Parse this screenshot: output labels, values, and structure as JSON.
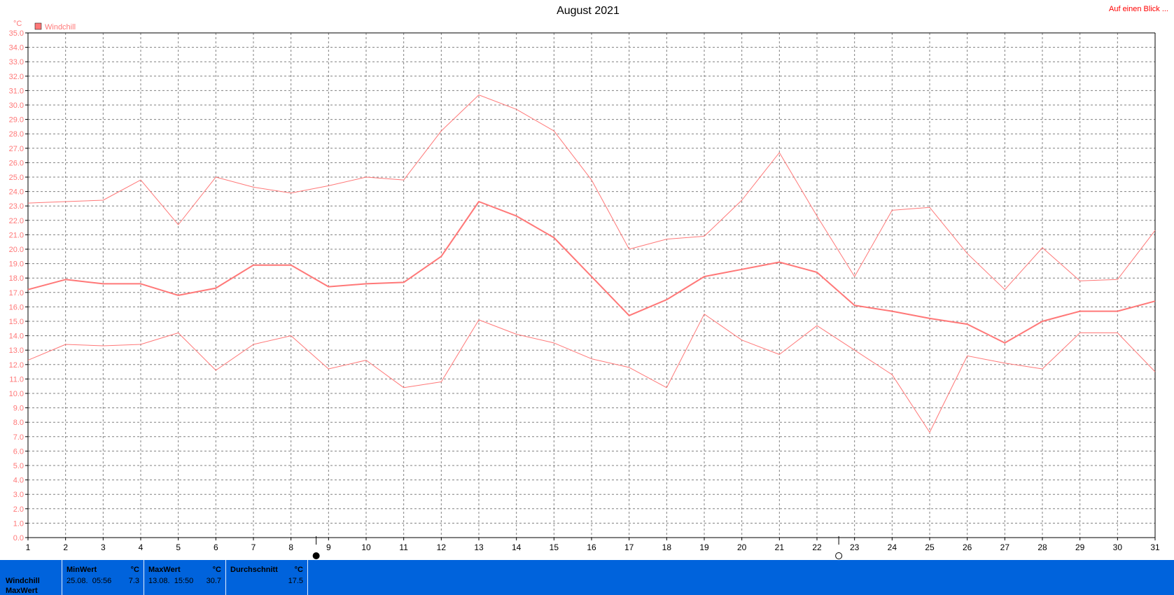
{
  "chart_data": {
    "type": "line",
    "title": "August 2021",
    "link": "Auf einen Blick ...",
    "yunit": "°C",
    "ylim": [
      0,
      35
    ],
    "ytick_step": 1,
    "x": [
      1,
      2,
      3,
      4,
      5,
      6,
      7,
      8,
      9,
      10,
      11,
      12,
      13,
      14,
      15,
      16,
      17,
      18,
      19,
      20,
      21,
      22,
      23,
      24,
      25,
      26,
      27,
      28,
      29,
      30,
      31
    ],
    "legend": [
      {
        "name": "Windchill",
        "color": "#ff7878"
      }
    ],
    "grid": true,
    "series": [
      {
        "role": "max",
        "color": "#ff7878",
        "width": 1,
        "values": [
          23.2,
          23.3,
          23.4,
          24.8,
          21.7,
          25.0,
          24.3,
          23.9,
          24.4,
          25.0,
          24.8,
          28.2,
          30.7,
          29.7,
          28.2,
          24.8,
          20.0,
          20.7,
          20.9,
          23.4,
          26.7,
          22.3,
          18.1,
          22.7,
          22.9,
          19.7,
          17.2,
          20.1,
          17.8,
          17.9,
          21.3
        ]
      },
      {
        "role": "avg",
        "color": "#ff7878",
        "width": 2,
        "values": [
          17.2,
          17.9,
          17.6,
          17.6,
          16.8,
          17.3,
          18.9,
          18.9,
          17.4,
          17.6,
          17.7,
          19.5,
          23.3,
          22.3,
          20.8,
          18.1,
          15.4,
          16.5,
          18.1,
          18.6,
          19.1,
          18.4,
          16.1,
          15.7,
          15.2,
          14.8,
          13.5,
          15.0,
          15.7,
          15.7,
          16.4
        ]
      },
      {
        "role": "min",
        "color": "#ff7878",
        "width": 1,
        "values": [
          12.3,
          13.4,
          13.3,
          13.4,
          14.2,
          11.6,
          13.4,
          14.0,
          11.7,
          12.3,
          10.4,
          10.8,
          15.1,
          14.1,
          13.5,
          12.4,
          11.8,
          10.4,
          15.5,
          13.7,
          12.7,
          14.7,
          13.0,
          11.3,
          7.3,
          12.6,
          12.1,
          11.7,
          14.2,
          14.2,
          11.5
        ]
      }
    ],
    "markers": [
      {
        "x": 8.67,
        "symbol": "filled-circle"
      },
      {
        "x": 22.58,
        "symbol": "open-circle"
      }
    ]
  },
  "stats": {
    "row_labels": [
      "Windchill",
      "MaxWert"
    ],
    "columns": [
      {
        "header": "MinWert",
        "unit": "°C",
        "value_text": "25.08.  05:56",
        "value": "7.3"
      },
      {
        "header": "MaxWert",
        "unit": "°C",
        "value_text": "13.08.  15:50",
        "value": "30.7"
      },
      {
        "header": "Durchschnitt",
        "unit": "°C",
        "value_text": "",
        "value": "17.5"
      }
    ]
  }
}
